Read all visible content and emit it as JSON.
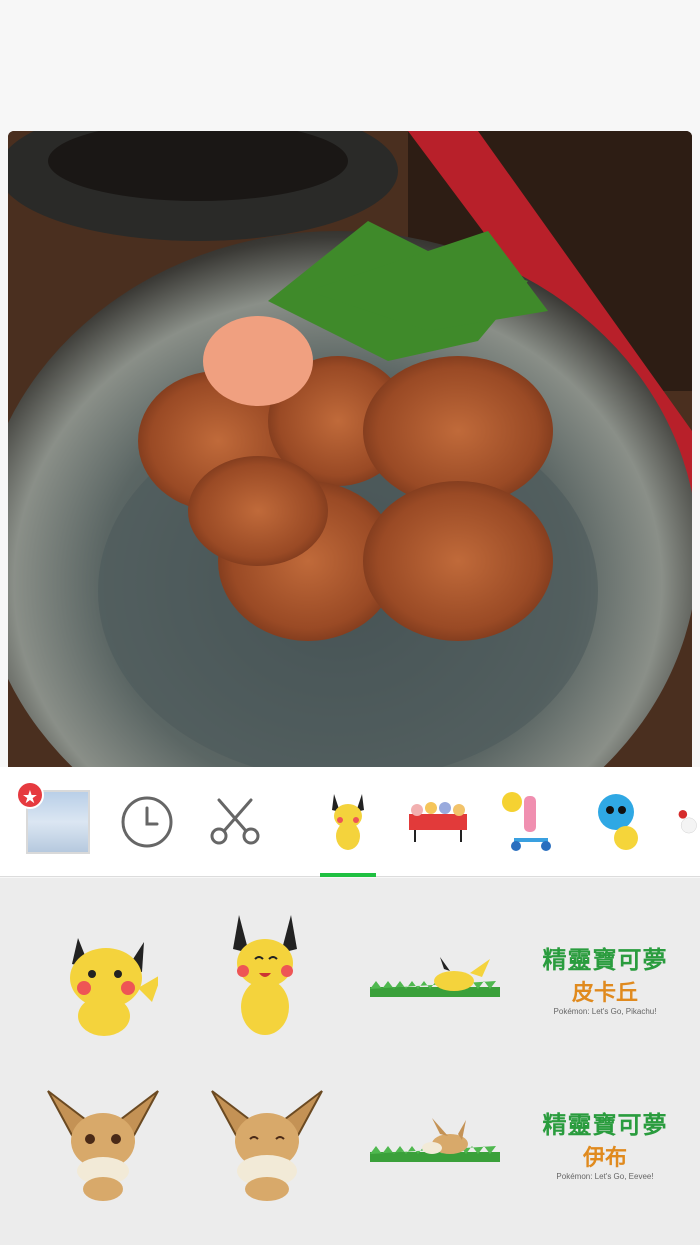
{
  "colors": {
    "accent": "#1fc041",
    "badge": "#e63a3f",
    "panel": "#ececec"
  },
  "tray": {
    "items": [
      {
        "name": "favorites-thumb",
        "icon": "star-badge-icon"
      },
      {
        "name": "recent",
        "icon": "clock-icon"
      },
      {
        "name": "cutout",
        "icon": "scissors-icon"
      },
      {
        "name": "pikachu-pack",
        "icon": "pikachu-sticker-icon",
        "selected": true
      },
      {
        "name": "group-pack",
        "icon": "group-banner-sticker-icon"
      },
      {
        "name": "scooter-pack",
        "icon": "scooter-sticker-icon"
      },
      {
        "name": "monster-pack",
        "icon": "blue-monster-sticker-icon"
      },
      {
        "name": "flower-pack",
        "icon": "flower-sticker-icon"
      }
    ],
    "badge_symbol": "★"
  },
  "stickers": {
    "row1": [
      {
        "name": "pikachu-wave"
      },
      {
        "name": "pikachu-happy"
      },
      {
        "name": "pikachu-lying"
      },
      {
        "name": "logo-pikachu",
        "title": "精靈寶可夢",
        "mid": "皮卡丘",
        "sub": "Pokémon: Let's Go, Pikachu!"
      }
    ],
    "row2": [
      {
        "name": "eevee-front"
      },
      {
        "name": "eevee-happy"
      },
      {
        "name": "eevee-lying"
      },
      {
        "name": "logo-eevee",
        "title": "精靈寶可夢",
        "mid": "伊布",
        "sub": "Pokémon: Let's Go, Eevee!"
      }
    ]
  }
}
